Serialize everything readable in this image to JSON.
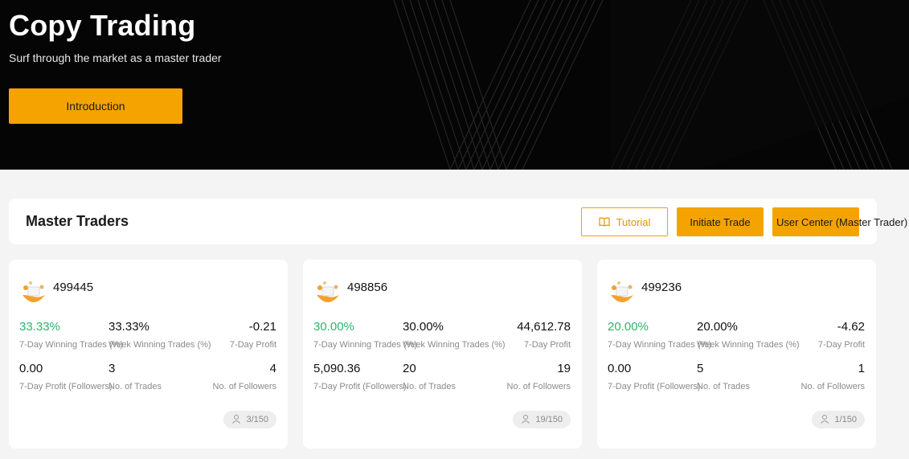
{
  "hero": {
    "title": "Copy Trading",
    "subtitle": "Surf through the market as a master trader",
    "intro_button": "Introduction"
  },
  "master_traders": {
    "title": "Master Traders",
    "tutorial_button": "Tutorial",
    "initiate_button": "Initiate Trade",
    "user_center_button": "User Center (Master Trader)"
  },
  "labels": {
    "win_rate": "7-Day Winning Trades (%)",
    "week_win": "Week Winning Trades (%)",
    "profit": "7-Day Profit",
    "follower_profit": "7-Day Profit (Followers)",
    "trades": "No. of Trades",
    "followers": "No. of Followers"
  },
  "traders": [
    {
      "id": "499445",
      "win_rate": "33.33%",
      "week_win": "33.33%",
      "profit": "-0.21",
      "follower_profit": "0.00",
      "trades": "3",
      "followers": "4",
      "capacity": "3/150"
    },
    {
      "id": "498856",
      "win_rate": "30.00%",
      "week_win": "30.00%",
      "profit": "44,612.78",
      "follower_profit": "5,090.36",
      "trades": "20",
      "followers": "19",
      "capacity": "19/150"
    },
    {
      "id": "499236",
      "win_rate": "20.00%",
      "week_win": "20.00%",
      "profit": "-4.62",
      "follower_profit": "0.00",
      "trades": "5",
      "followers": "1",
      "capacity": "1/150"
    }
  ],
  "colors": {
    "accent": "#f5a300",
    "positive": "#2db36a",
    "hero_bg": "#050505",
    "page_bg": "#f4f4f4"
  },
  "icons": {
    "tutorial": "book-icon",
    "capacity": "user-icon",
    "avatar": "trader-avatar-icon"
  }
}
